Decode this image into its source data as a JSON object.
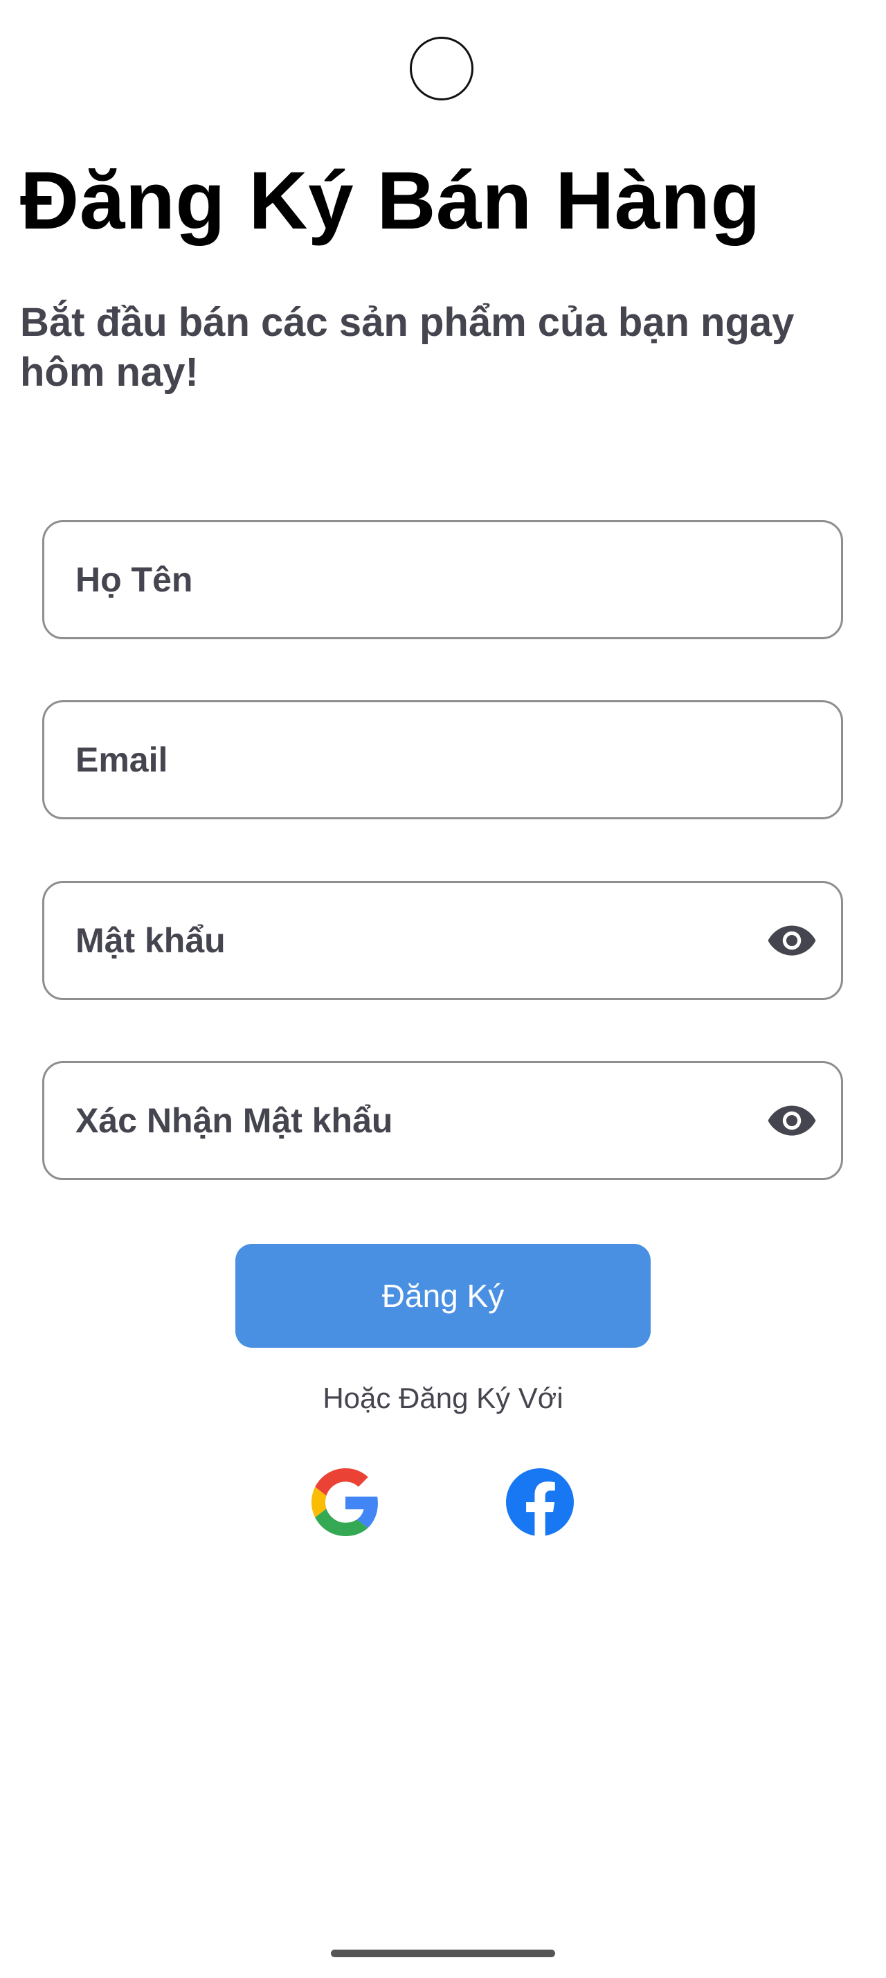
{
  "header": {
    "title": "Đăng Ký Bán Hàng",
    "subtitle": "Bắt đầu bán các sản phẩm của bạn ngay hôm nay!"
  },
  "form": {
    "full_name_placeholder": "Họ Tên",
    "email_placeholder": "Email",
    "password_placeholder": "Mật khẩu",
    "confirm_password_placeholder": "Xác Nhận Mật khẩu",
    "submit_label": "Đăng Ký"
  },
  "social": {
    "divider_text": "Hoặc Đăng Ký Với",
    "providers": [
      "google-icon",
      "facebook-icon"
    ]
  },
  "icons": {
    "password_toggle": "eye-icon",
    "confirm_password_toggle": "eye-icon"
  },
  "colors": {
    "primary_button": "#4a90e2",
    "field_border": "#8e8e8e",
    "secondary_text": "#45454f",
    "facebook_blue": "#1877f2"
  }
}
